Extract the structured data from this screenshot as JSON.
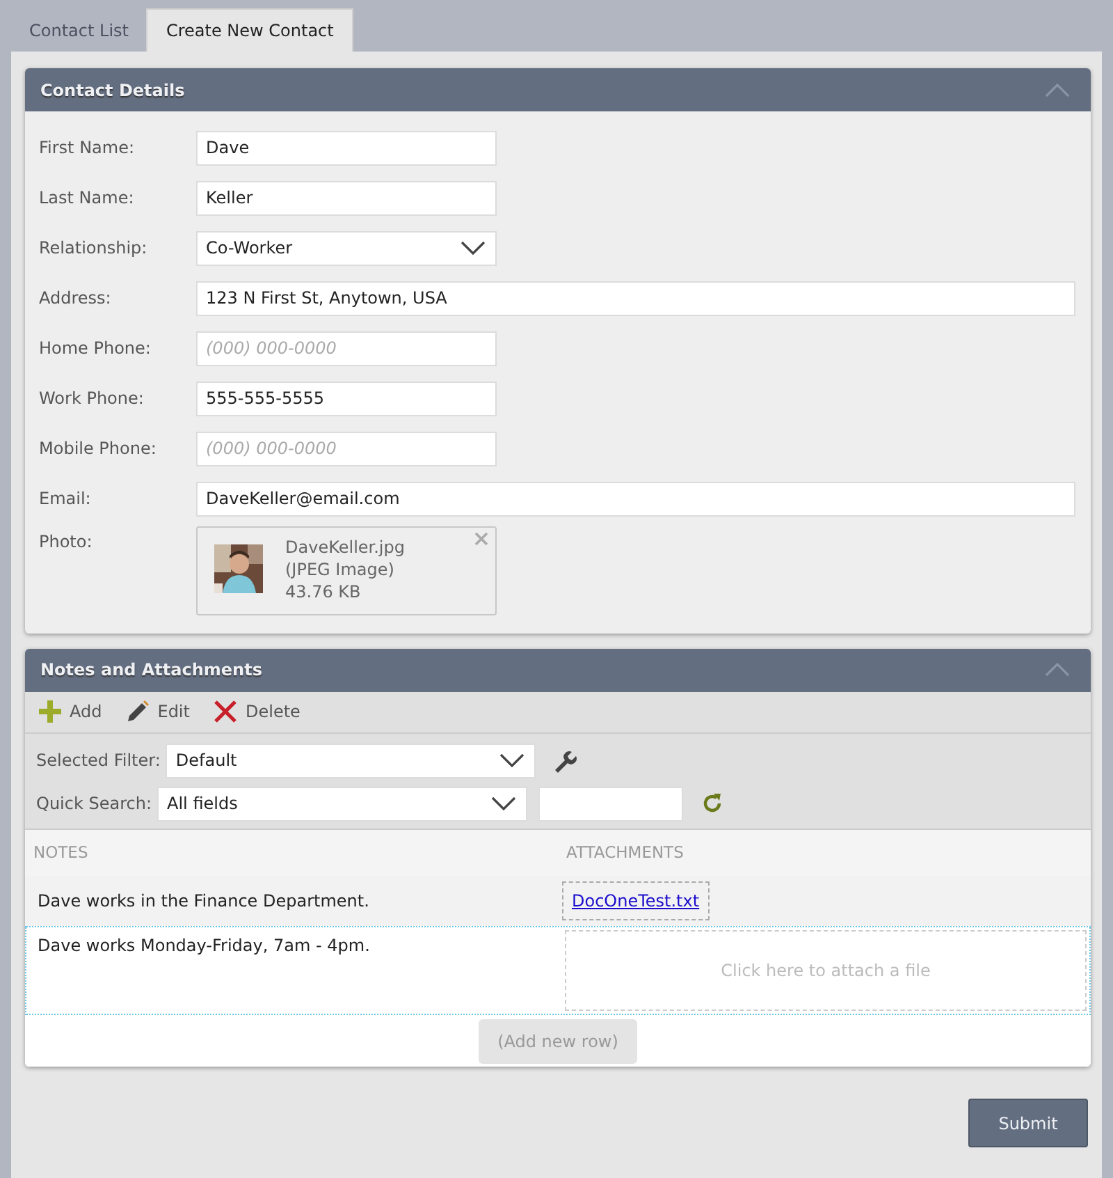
{
  "tabs": [
    {
      "label": "Contact List",
      "selected": false
    },
    {
      "label": "Create New Contact",
      "selected": true
    }
  ],
  "contact_details": {
    "title": "Contact Details",
    "expanded": true,
    "fields": [
      {
        "label": "First Name:",
        "kind": "text",
        "value": "Dave"
      },
      {
        "label": "Last Name:",
        "kind": "text",
        "value": "Keller"
      },
      {
        "label": "Relationship:",
        "kind": "select",
        "value": "Co-Worker"
      },
      {
        "label": "Address:",
        "kind": "wide_text",
        "value": "123 N First St, Anytown, USA"
      },
      {
        "label": "Home Phone:",
        "kind": "text",
        "placeholder": "(000) 000-0000"
      },
      {
        "label": "Work Phone:",
        "kind": "text",
        "value": "555-555-5555"
      },
      {
        "label": "Mobile Phone:",
        "kind": "text",
        "placeholder": "(000) 000-0000"
      },
      {
        "label": "Email:",
        "kind": "wide_text",
        "value": "DaveKeller@email.com"
      },
      {
        "label": "Photo:",
        "file": {
          "name": "DaveKeller.jpg",
          "type": "(JPEG Image)",
          "size": "43.76 KB"
        }
      }
    ]
  },
  "notes": {
    "title": "Notes and Attachments",
    "expanded": true,
    "toolbar": [
      {
        "label": "Add",
        "kind": "add"
      },
      {
        "label": "Edit",
        "kind": "edit"
      },
      {
        "label": "Delete",
        "kind": "delete"
      }
    ],
    "filter": {
      "label": "Selected Filter:",
      "value": "Default"
    },
    "quick_search": {
      "label": "Quick Search:",
      "field": "All fields"
    },
    "columns": [
      "NOTES",
      "ATTACHMENTS"
    ],
    "rows": [
      {
        "note": "Dave works in the Finance Department.",
        "attachment": "DocOneTest.txt",
        "selected": false
      },
      {
        "note": "Dave works Monday-Friday, 7am - 4pm.",
        "attach_hint": "Click here to attach a file",
        "selected": true
      }
    ],
    "add_row": "(Add new row)"
  },
  "submit": "Submit"
}
